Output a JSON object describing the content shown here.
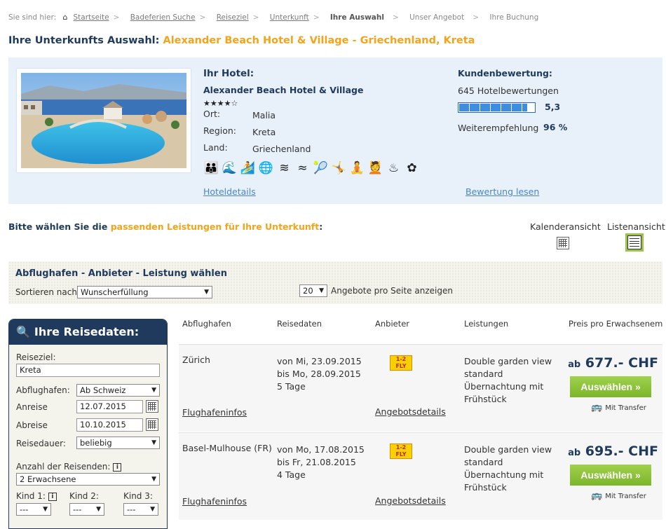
{
  "breadcrumb": {
    "prefix": "Sie sind hier:",
    "items": [
      "Startseite",
      "Badeferien Suche",
      "Reiseziel",
      "Unterkunft",
      "Ihre Auswahl",
      "Unser Angebot",
      "Ihre Buchung"
    ]
  },
  "title": {
    "prefix": "Ihre Unterkunfts Auswahl:",
    "hotel": "Alexander Beach Hotel & Village - Griechenland, Kreta"
  },
  "hotel": {
    "heading": "Ihr Hotel:",
    "name": "Alexander Beach Hotel & Village",
    "stars": "★★★★☆",
    "ort_label": "Ort:",
    "ort": "Malia",
    "region_label": "Region:",
    "region": "Kreta",
    "land_label": "Land:",
    "land": "Griechenland",
    "details_link": "Hoteldetails",
    "amenities": [
      "family-icon",
      "beach-icon",
      "watersport-icon",
      "internet-icon",
      "pool-icon",
      "pool-outdoor-icon",
      "tennis-icon",
      "aerobic-icon",
      "wellness-icon",
      "massage-icon",
      "sauna-icon",
      "spa-icon"
    ]
  },
  "rating": {
    "heading": "Kundenbewertung:",
    "count": "645 Hotelbewertungen",
    "score": "5,3",
    "score_fraction": 0.88,
    "recommend_label": "Weiterempfehlung",
    "recommend_value": "96 %",
    "read_link": "Bewertung lesen"
  },
  "choose": {
    "prefix": "Bitte wählen Sie die",
    "highlight": "passenden Leistungen für Ihre Unterkunft",
    "suffix": ":",
    "calendar_view": "Kalenderansicht",
    "list_view": "Listenansicht"
  },
  "filter": {
    "title": "Abflughafen - Anbieter - Leistung wählen",
    "sort_label": "Sortieren nach",
    "sort_value": "Wunscherfüllung",
    "per_page_value": "20",
    "per_page_label": "Angebote pro Seite anzeigen"
  },
  "travel": {
    "heading": "Ihre Reisedaten:",
    "destination_label": "Reiseziel:",
    "destination_value": "Kreta",
    "airport_label": "Abflughafen:",
    "airport_value": "Ab Schweiz",
    "departure_label": "Anreise",
    "departure_value": "12.07.2015",
    "return_label": "Abreise",
    "return_value": "10.10.2015",
    "duration_label": "Reisedauer:",
    "duration_value": "beliebig",
    "travellers_label": "Anzahl der Reisenden:",
    "travellers_value": "2 Erwachsene",
    "child1_label": "Kind 1:",
    "child2_label": "Kind 2:",
    "child3_label": "Kind 3:",
    "child_value": "---"
  },
  "table": {
    "headers": [
      "Abflughafen",
      "Reisedaten",
      "Anbieter",
      "Leistungen",
      "Preis pro Erwachsenem"
    ],
    "rows": [
      {
        "airport": "Zürich",
        "from": "von Mi, 23.09.2015",
        "to": "bis  Mo, 28.09.2015",
        "days": "5 Tage",
        "service": [
          "Double garden view",
          "standard",
          "Übernachtung mit",
          "Frühstück"
        ],
        "price_prefix": "ab",
        "price": "677.- CHF",
        "button": "Auswählen",
        "transfer": "Mit Transfer",
        "airport_link": "Flughafeninfos",
        "offer_link": "Angebotsdetails"
      },
      {
        "airport": "Basel-Mulhouse (FR)",
        "from": "von Mo, 17.08.2015",
        "to": "bis  Fr, 21.08.2015",
        "days": "4 Tage",
        "service": [
          "Double garden view",
          "standard",
          "Übernachtung mit",
          "Frühstück"
        ],
        "price_prefix": "ab",
        "price": "695.- CHF",
        "button": "Auswählen",
        "transfer": "Mit Transfer",
        "airport_link": "Flughafeninfos",
        "offer_link": "Angebotsdetails"
      }
    ]
  },
  "colors": {
    "accent": "#f5a31a",
    "navy": "#1f3a5c",
    "button": "#8dc63f",
    "link": "#4a86c8"
  }
}
